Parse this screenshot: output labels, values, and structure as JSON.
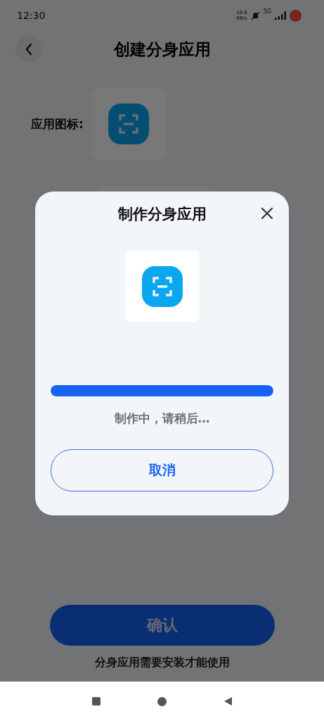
{
  "status_bar": {
    "time": "12:30",
    "net_speed": "10.6",
    "net_unit": "KB/s",
    "network": "5G"
  },
  "header": {
    "title": "创建分身应用"
  },
  "form": {
    "icon_label": "应用图标:"
  },
  "confirm_button": {
    "label": "确认",
    "disabled": true
  },
  "footnote": "分身应用需要安装才能使用",
  "dialog": {
    "title": "制作分身应用",
    "progress": {
      "level": 1
    },
    "status": "制作中，请稍后…",
    "cancel_button": "取消"
  }
}
